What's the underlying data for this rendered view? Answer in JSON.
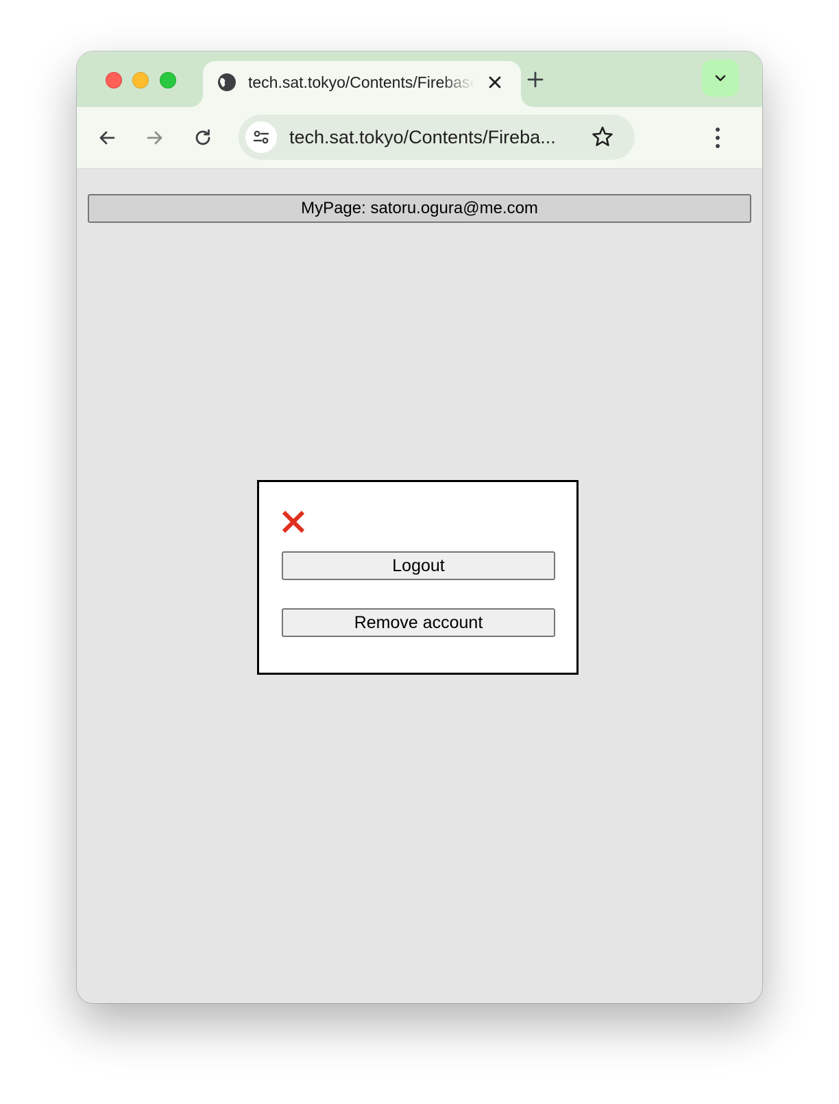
{
  "browser": {
    "tab": {
      "title": "tech.sat.tokyo/Contents/Firebase",
      "icon": "globe-icon"
    },
    "address_bar": {
      "url": "tech.sat.tokyo/Contents/Fireba..."
    },
    "colors": {
      "tabstrip": "#cfe6cd",
      "toolbar": "#f3f9f1",
      "tab_search": "#b9f5b3"
    }
  },
  "page": {
    "header_button": "MyPage: satoru.ogura@me.com",
    "dialog": {
      "close_icon": "close-x-icon",
      "close_color": "#e0301e",
      "logout_label": "Logout",
      "remove_account_label": "Remove account"
    }
  }
}
